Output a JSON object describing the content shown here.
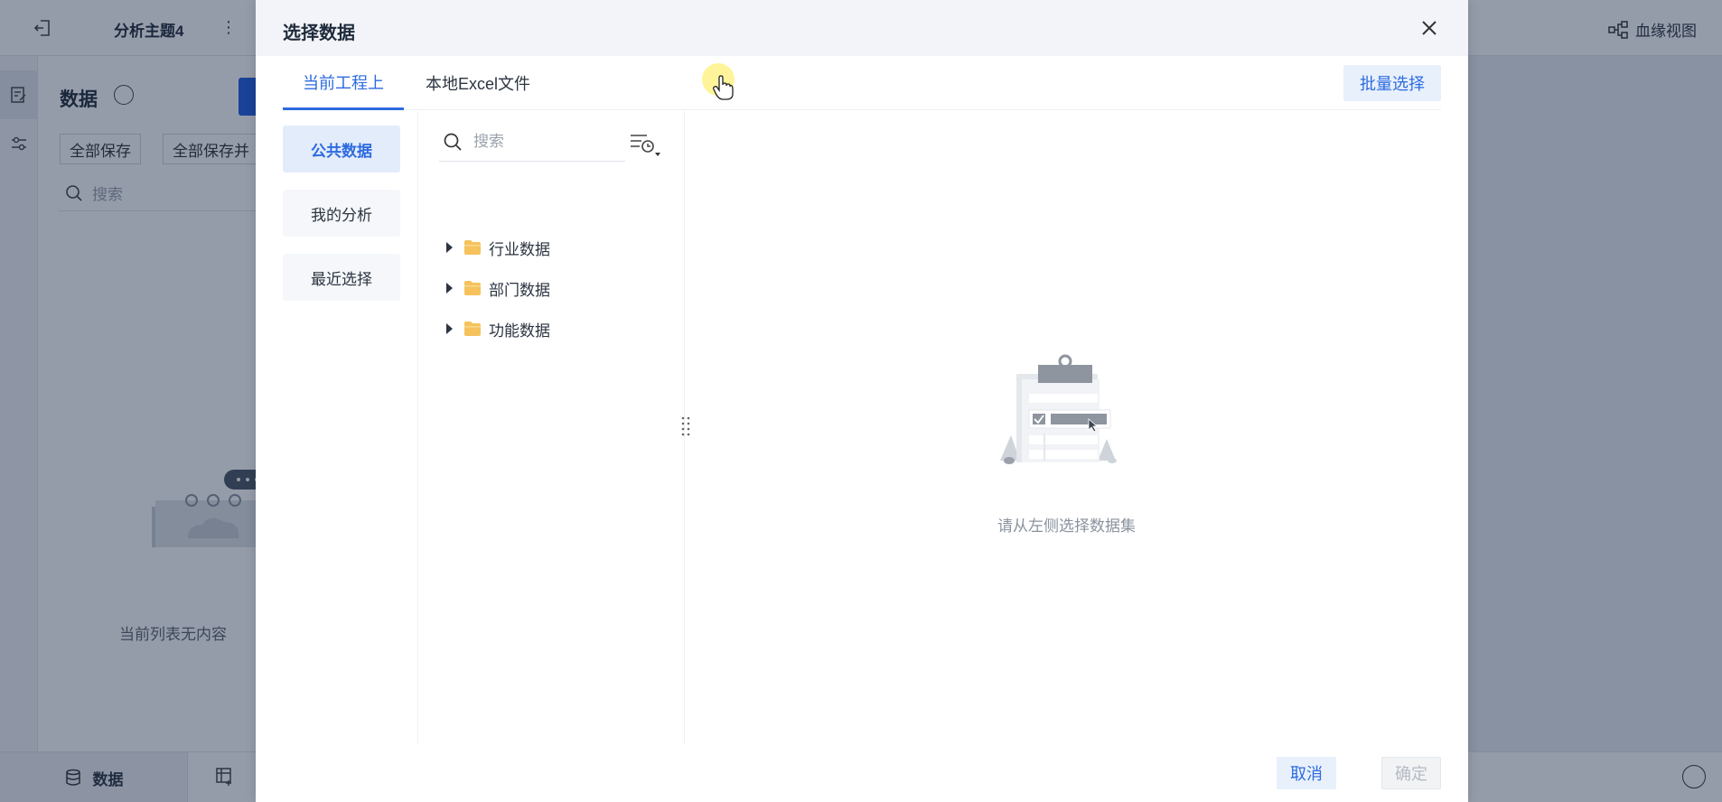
{
  "app": {
    "title": "分析主题4",
    "lineage_label": "血缘视图",
    "panel": {
      "title": "数据",
      "save_all": "全部保存",
      "save_all_and": "全部保存并",
      "search_placeholder": "搜索",
      "empty_text": "当前列表无内容"
    },
    "bottom_tab": "数据"
  },
  "modal": {
    "title": "选择数据",
    "tabs": [
      {
        "label": "当前工程上",
        "active": true
      },
      {
        "label": "本地Excel文件",
        "active": false
      }
    ],
    "batch_select": "批量选择",
    "categories": [
      {
        "label": "公共数据",
        "active": true
      },
      {
        "label": "我的分析",
        "active": false
      },
      {
        "label": "最近选择",
        "active": false
      }
    ],
    "search_placeholder": "搜索",
    "tree": [
      {
        "label": "行业数据"
      },
      {
        "label": "部门数据"
      },
      {
        "label": "功能数据"
      }
    ],
    "empty_hint": "请从左侧选择数据集",
    "cancel": "取消",
    "confirm": "确定"
  },
  "colors": {
    "accent": "#2d6bdf",
    "folder": "#f5c25c",
    "overlay": "rgba(20,35,65,0.45)"
  }
}
